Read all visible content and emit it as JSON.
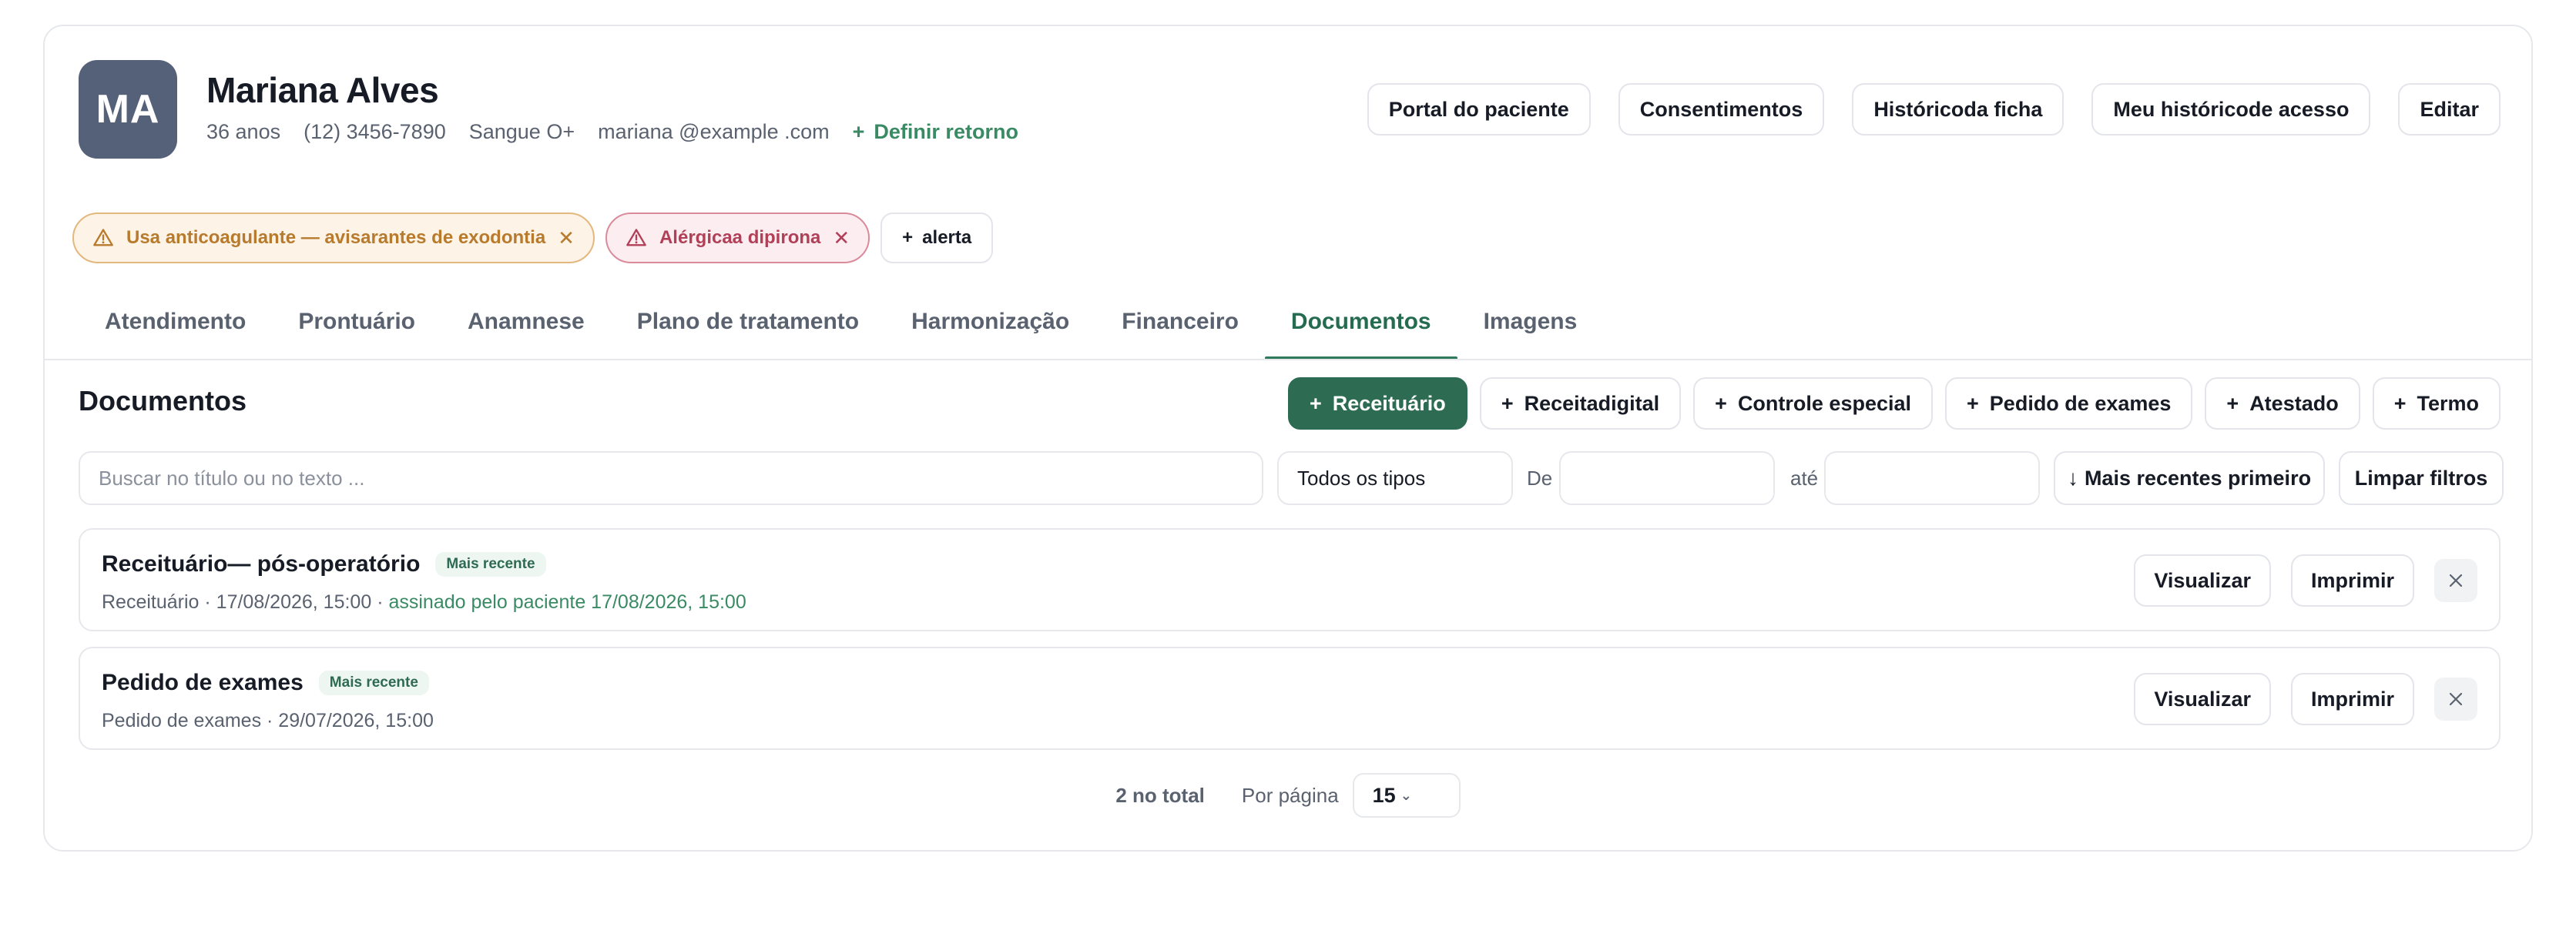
{
  "patient": {
    "initials": "MA",
    "name": "Mariana Alves",
    "age": "36 anos",
    "phone": "(12) 3456-7890",
    "blood": "Sangue O+",
    "email": "mariana @example .com",
    "retorno_label": "Definir retorno"
  },
  "header_actions": {
    "portal": "Portal do paciente",
    "consentimentos": "Consentimentos",
    "historico_ficha": "Históricoda ficha",
    "historico_acesso": "Meu históricode acesso",
    "editar": "Editar"
  },
  "alerts": {
    "items": [
      {
        "text": "Usa anticoagulante — avisarantes de exodontia"
      },
      {
        "text": "Alérgicaa dipirona"
      }
    ],
    "add_label": "alerta"
  },
  "tabs": [
    {
      "label": "Atendimento"
    },
    {
      "label": "Prontuário"
    },
    {
      "label": "Anamnese"
    },
    {
      "label": "Plano de tratamento"
    },
    {
      "label": "Harmonização"
    },
    {
      "label": "Financeiro"
    },
    {
      "label": "Documentos"
    },
    {
      "label": "Imagens"
    }
  ],
  "active_tab": "Documentos",
  "documents": {
    "title": "Documentos",
    "actions": {
      "receituario": "Receituário",
      "receita_digital": "Receitadigital",
      "controle_especial": "Controle especial",
      "pedido_exames": "Pedido de exames",
      "atestado": "Atestado",
      "termo": "Termo"
    },
    "filters": {
      "search_placeholder": "Buscar no título ou no texto ...",
      "type_value": "Todos os tipos",
      "from_label": "De",
      "to_label": "até",
      "sort_label": "Mais recentes primeiro",
      "clear_label": "Limpar filtros"
    },
    "rows": [
      {
        "title": "Receituário— pós-operatório",
        "badge": "Mais recente",
        "subtitle": "Receituário · 17/08/2026, 15:00 ·",
        "signed": "assinado pelo paciente 17/08/2026, 15:00",
        "view_label": "Visualizar",
        "print_label": "Imprimir"
      },
      {
        "title": "Pedido de exames",
        "badge": "Mais recente",
        "subtitle": "Pedido de exames · 29/07/2026, 15:00",
        "signed": "",
        "view_label": "Visualizar",
        "print_label": "Imprimir"
      }
    ],
    "pager": {
      "total": "2 no total",
      "per_page_label": "Por página",
      "per_page_value": "15"
    }
  },
  "colors": {
    "accent": "#2d6b53",
    "avatar": "#556079",
    "alert_orange": "#b87a2c",
    "alert_red": "#b13f57"
  }
}
